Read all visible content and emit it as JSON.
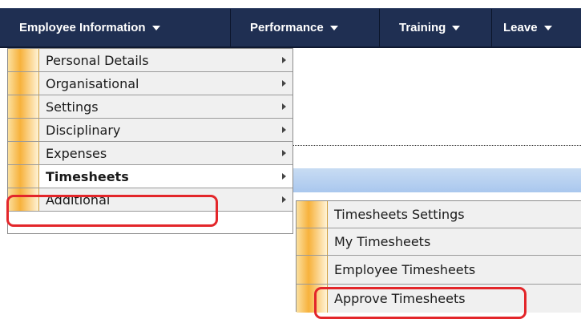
{
  "nav": {
    "items": [
      {
        "label": "Employee Information"
      },
      {
        "label": "Performance"
      },
      {
        "label": "Training"
      },
      {
        "label": "Leave"
      }
    ]
  },
  "menu": {
    "items": [
      {
        "label": "Personal Details"
      },
      {
        "label": "Organisational"
      },
      {
        "label": "Settings"
      },
      {
        "label": "Disciplinary"
      },
      {
        "label": "Expenses"
      },
      {
        "label": "Timesheets"
      },
      {
        "label": "Additional"
      }
    ]
  },
  "submenu": {
    "items": [
      {
        "label": "Timesheets Settings"
      },
      {
        "label": "My Timesheets"
      },
      {
        "label": "Employee Timesheets"
      },
      {
        "label": "Approve Timesheets"
      }
    ]
  },
  "colors": {
    "nav_background": "#1f2f52",
    "highlight": "#e3262a",
    "menu_accent": "#f7b23c"
  }
}
